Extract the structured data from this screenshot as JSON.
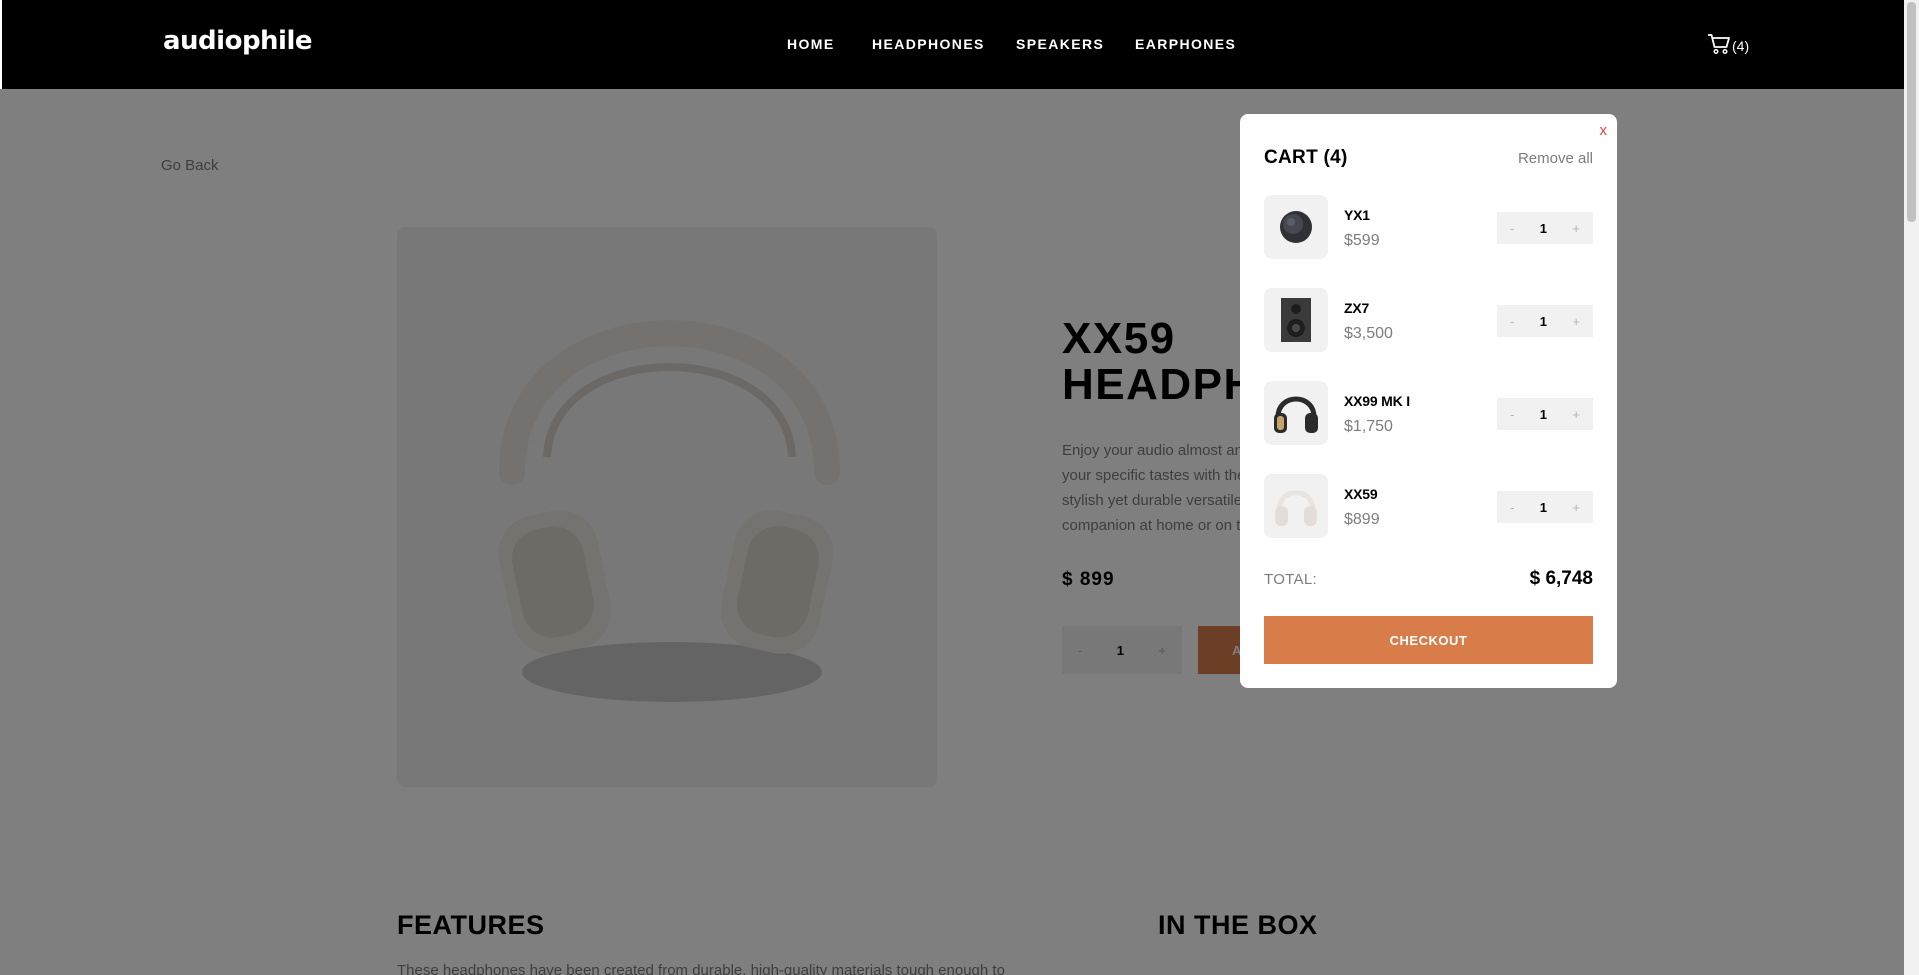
{
  "header": {
    "logo": "audiophile",
    "nav": [
      "HOME",
      "HEADPHONES",
      "SPEAKERS",
      "EARPHONES"
    ],
    "cart_count": "(4)"
  },
  "page": {
    "go_back": "Go Back",
    "product": {
      "title_line1": "XX59",
      "title_line2": "HEADPHONES",
      "description": "Enjoy your audio almost anywhere and customize it to your specific tastes with the XX59 headphones. The stylish yet durable versatile wireless headset is a brilliant companion at home or on the move.",
      "price": "$ 899",
      "quantity": "1",
      "minus": "-",
      "plus": "+",
      "add_to_cart": "ADD TO CART"
    },
    "features_title": "FEATURES",
    "in_the_box_title": "IN THE BOX",
    "features_text": "These headphones have been created from durable, high-quality materials tough enough to"
  },
  "cart": {
    "close": "x",
    "title": "CART (4)",
    "remove_all": "Remove all",
    "items": [
      {
        "name": "YX1",
        "price": "$599",
        "quantity": "1",
        "minus": "-",
        "plus": "+",
        "thumb": "earphone-icon"
      },
      {
        "name": "ZX7",
        "price": "$3,500",
        "quantity": "1",
        "minus": "-",
        "plus": "+",
        "thumb": "speaker-icon"
      },
      {
        "name": "XX99 MK I",
        "price": "$1,750",
        "quantity": "1",
        "minus": "-",
        "plus": "+",
        "thumb": "headphones-dark-icon"
      },
      {
        "name": "XX59",
        "price": "$899",
        "quantity": "1",
        "minus": "-",
        "plus": "+",
        "thumb": "headphones-white-icon"
      }
    ],
    "total_label": "TOTAL:",
    "total_value": "$ 6,748",
    "checkout": "CHECKOUT"
  },
  "colors": {
    "accent": "#d87d4a",
    "header_bg": "#000000",
    "muted_text": "#7d7d7d",
    "panel_bg": "#f1f1f1",
    "close_red": "#e04040"
  }
}
